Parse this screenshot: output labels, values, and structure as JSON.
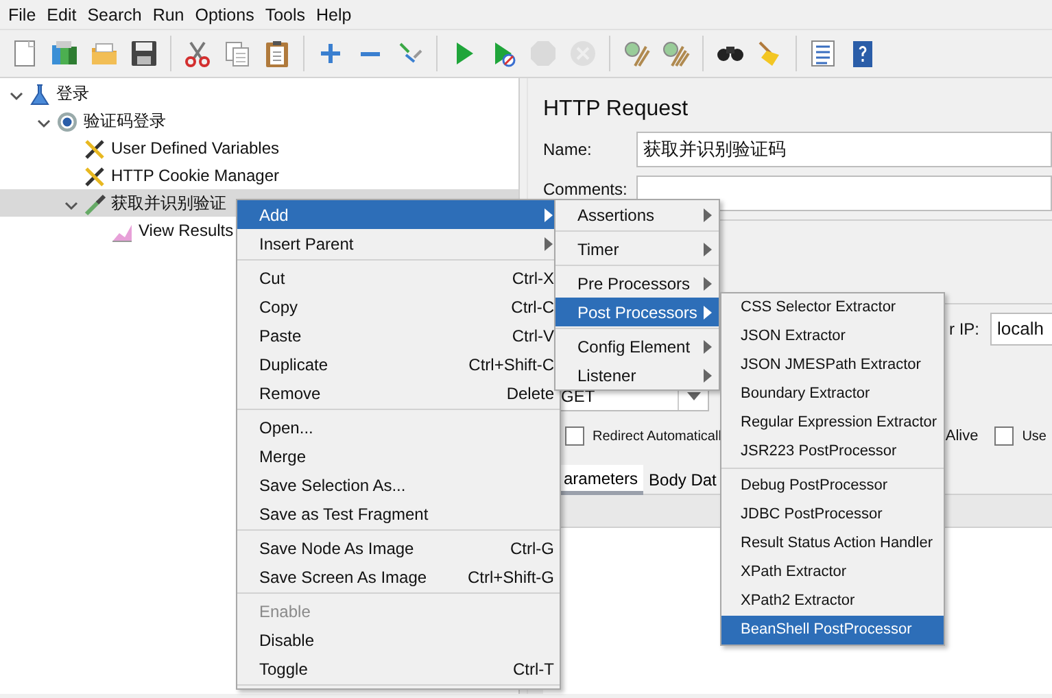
{
  "menubar": [
    {
      "label": "File"
    },
    {
      "label": "Edit"
    },
    {
      "label": "Search"
    },
    {
      "label": "Run"
    },
    {
      "label": "Options"
    },
    {
      "label": "Tools"
    },
    {
      "label": "Help"
    }
  ],
  "toolbar": [
    {
      "kind": "new",
      "disabled": false
    },
    {
      "kind": "templates",
      "disabled": false
    },
    {
      "kind": "open",
      "disabled": false
    },
    {
      "kind": "save",
      "disabled": false
    },
    {
      "kind": "sep"
    },
    {
      "kind": "cut",
      "disabled": false
    },
    {
      "kind": "copy",
      "disabled": false
    },
    {
      "kind": "paste",
      "disabled": false
    },
    {
      "kind": "sep"
    },
    {
      "kind": "expand",
      "disabled": false
    },
    {
      "kind": "collapse",
      "disabled": false
    },
    {
      "kind": "toggle",
      "disabled": false
    },
    {
      "kind": "sep"
    },
    {
      "kind": "start",
      "disabled": false
    },
    {
      "kind": "start-no-timers",
      "disabled": false
    },
    {
      "kind": "stop",
      "disabled": true
    },
    {
      "kind": "shutdown",
      "disabled": true
    },
    {
      "kind": "sep"
    },
    {
      "kind": "clear",
      "disabled": false
    },
    {
      "kind": "clear-all",
      "disabled": false
    },
    {
      "kind": "sep"
    },
    {
      "kind": "search",
      "disabled": false
    },
    {
      "kind": "reset-search",
      "disabled": false
    },
    {
      "kind": "sep"
    },
    {
      "kind": "function-helper",
      "disabled": false
    },
    {
      "kind": "help",
      "disabled": false
    }
  ],
  "tree": [
    {
      "label": "登录",
      "kind": "test-plan",
      "expanded": true,
      "selected": false,
      "children": [
        {
          "label": "验证码登录",
          "kind": "thread-group",
          "expanded": true,
          "selected": false,
          "children": [
            {
              "label": "User Defined Variables",
              "kind": "config",
              "selected": false
            },
            {
              "label": "HTTP Cookie Manager",
              "kind": "config",
              "selected": false
            },
            {
              "label": "获取并识别验证",
              "kind": "sampler",
              "expanded": true,
              "selected": true,
              "children": [
                {
                  "label": "View Results",
                  "kind": "listener",
                  "selected": false
                }
              ]
            }
          ]
        }
      ]
    }
  ],
  "panel": {
    "title": "HTTP Request",
    "name_label": "Name:",
    "name_value": "获取并识别验证码",
    "comments_label": "Comments:",
    "server_label": "r IP:",
    "server_value": "localh",
    "method": "GET",
    "options": [
      {
        "kind": "checkbox",
        "label": "Redirect Automaticall",
        "checked": false
      },
      {
        "kind": "text",
        "label": "Alive"
      },
      {
        "kind": "checkbox",
        "label": "Use",
        "checked": false
      }
    ],
    "tabs": [
      {
        "label": "arameters",
        "selected": true
      },
      {
        "label": "Body Dat",
        "selected": false
      }
    ]
  },
  "context_menu": [
    {
      "kind": "item",
      "label": "Add",
      "submenu": true,
      "selected": true,
      "disabled": false
    },
    {
      "kind": "item",
      "label": "Insert Parent",
      "submenu": true,
      "selected": false,
      "disabled": false
    },
    {
      "kind": "separator"
    },
    {
      "kind": "item",
      "label": "Cut",
      "shortcut": "Ctrl-X",
      "selected": false,
      "disabled": false
    },
    {
      "kind": "item",
      "label": "Copy",
      "shortcut": "Ctrl-C",
      "selected": false,
      "disabled": false
    },
    {
      "kind": "item",
      "label": "Paste",
      "shortcut": "Ctrl-V",
      "selected": false,
      "disabled": false
    },
    {
      "kind": "item",
      "label": "Duplicate",
      "shortcut": "Ctrl+Shift-C",
      "selected": false,
      "disabled": false
    },
    {
      "kind": "item",
      "label": "Remove",
      "shortcut": "Delete",
      "selected": false,
      "disabled": false
    },
    {
      "kind": "separator"
    },
    {
      "kind": "item",
      "label": "Open...",
      "selected": false,
      "disabled": false
    },
    {
      "kind": "item",
      "label": "Merge",
      "selected": false,
      "disabled": false
    },
    {
      "kind": "item",
      "label": "Save Selection As...",
      "selected": false,
      "disabled": false
    },
    {
      "kind": "item",
      "label": "Save as Test Fragment",
      "selected": false,
      "disabled": false
    },
    {
      "kind": "separator"
    },
    {
      "kind": "item",
      "label": "Save Node As Image",
      "shortcut": "Ctrl-G",
      "selected": false,
      "disabled": false
    },
    {
      "kind": "item",
      "label": "Save Screen As Image",
      "shortcut": "Ctrl+Shift-G",
      "selected": false,
      "disabled": false
    },
    {
      "kind": "separator"
    },
    {
      "kind": "item",
      "label": "Enable",
      "selected": false,
      "disabled": true
    },
    {
      "kind": "item",
      "label": "Disable",
      "selected": false,
      "disabled": false
    },
    {
      "kind": "item",
      "label": "Toggle",
      "shortcut": "Ctrl-T",
      "selected": false,
      "disabled": false
    },
    {
      "kind": "separator"
    }
  ],
  "add_submenu": [
    {
      "kind": "item",
      "label": "Assertions",
      "submenu": true,
      "selected": false
    },
    {
      "kind": "separator"
    },
    {
      "kind": "item",
      "label": "Timer",
      "submenu": true,
      "selected": false
    },
    {
      "kind": "separator"
    },
    {
      "kind": "item",
      "label": "Pre Processors",
      "submenu": true,
      "selected": false
    },
    {
      "kind": "item",
      "label": "Post Processors",
      "submenu": true,
      "selected": true
    },
    {
      "kind": "separator"
    },
    {
      "kind": "item",
      "label": "Config Element",
      "submenu": true,
      "selected": false
    },
    {
      "kind": "item",
      "label": "Listener",
      "submenu": true,
      "selected": false
    }
  ],
  "post_processors_submenu": [
    {
      "kind": "item",
      "label": "CSS Selector Extractor",
      "selected": false
    },
    {
      "kind": "item",
      "label": "JSON Extractor",
      "selected": false
    },
    {
      "kind": "item",
      "label": "JSON JMESPath Extractor",
      "selected": false
    },
    {
      "kind": "item",
      "label": "Boundary Extractor",
      "selected": false
    },
    {
      "kind": "item",
      "label": "Regular Expression Extractor",
      "selected": false
    },
    {
      "kind": "item",
      "label": "JSR223 PostProcessor",
      "selected": false
    },
    {
      "kind": "separator"
    },
    {
      "kind": "item",
      "label": "Debug PostProcessor",
      "selected": false
    },
    {
      "kind": "item",
      "label": "JDBC PostProcessor",
      "selected": false
    },
    {
      "kind": "item",
      "label": "Result Status Action Handler",
      "selected": false
    },
    {
      "kind": "item",
      "label": "XPath Extractor",
      "selected": false
    },
    {
      "kind": "item",
      "label": "XPath2 Extractor",
      "selected": false
    },
    {
      "kind": "item",
      "label": "BeanShell PostProcessor",
      "selected": true
    }
  ]
}
